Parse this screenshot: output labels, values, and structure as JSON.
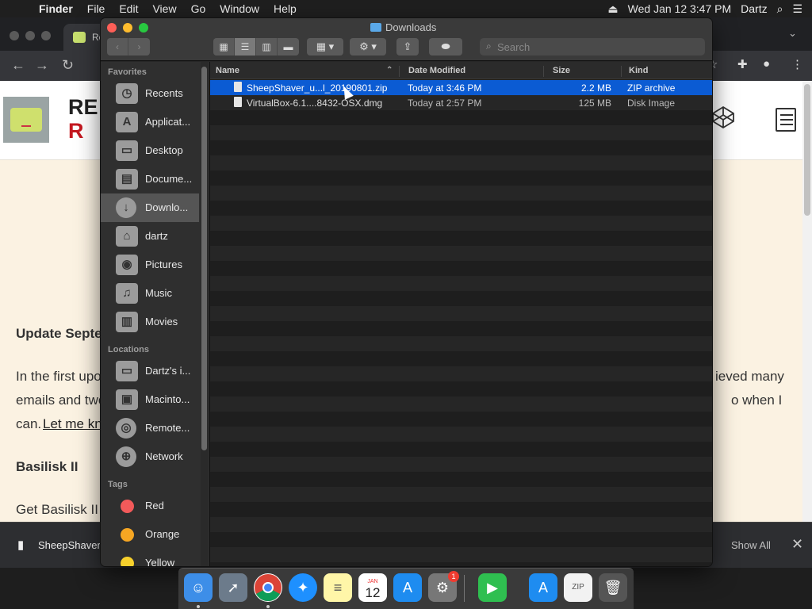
{
  "menubar": {
    "apple_icon": "apple-icon",
    "items": [
      "Finder",
      "File",
      "Edit",
      "View",
      "Go",
      "Window",
      "Help"
    ],
    "datetime": "Wed Jan 12  3:47 PM",
    "user": "Dartz"
  },
  "chrome": {
    "tab_label": "Re",
    "site_title_line1": "RE",
    "site_title_line2": "R",
    "content": {
      "heading1": "Update Septe",
      "para1_line1": "In the first upo",
      "para1_line1_right": "ieved many",
      "para1_line2": "emails and twe",
      "para1_line2_right": "o when I",
      "para1_line3_prefix": "can.",
      "para1_line3_link": "Let me kn",
      "heading2": "Basilisk II",
      "para2": "Get Basilisk II ("
    },
    "download_bar": {
      "file_name": "SheepShaver",
      "show_all": "Show All",
      "close_icon": "close-icon"
    }
  },
  "finder": {
    "title": "Downloads",
    "search_placeholder": "Search",
    "sidebar": {
      "favorites_heading": "Favorites",
      "favorites": [
        {
          "label": "Recents",
          "icon": "clock-icon"
        },
        {
          "label": "Applicat...",
          "icon": "applications-icon"
        },
        {
          "label": "Desktop",
          "icon": "desktop-icon"
        },
        {
          "label": "Docume...",
          "icon": "documents-icon"
        },
        {
          "label": "Downlo...",
          "icon": "downloads-icon"
        },
        {
          "label": "dartz",
          "icon": "home-icon"
        },
        {
          "label": "Pictures",
          "icon": "pictures-icon"
        },
        {
          "label": "Music",
          "icon": "music-icon"
        },
        {
          "label": "Movies",
          "icon": "movies-icon"
        }
      ],
      "locations_heading": "Locations",
      "locations": [
        {
          "label": "Dartz's i...",
          "icon": "computer-icon"
        },
        {
          "label": "Macinto...",
          "icon": "hard-drive-icon"
        },
        {
          "label": "Remote...",
          "icon": "remote-disc-icon"
        },
        {
          "label": "Network",
          "icon": "network-icon"
        }
      ],
      "tags_heading": "Tags",
      "tags": [
        {
          "label": "Red",
          "color": "#f25a5a"
        },
        {
          "label": "Orange",
          "color": "#f6a623"
        },
        {
          "label": "Yellow",
          "color": "#f7d02c"
        }
      ]
    },
    "columns": {
      "name": "Name",
      "date_modified": "Date Modified",
      "size": "Size",
      "kind": "Kind"
    },
    "files": [
      {
        "name": "SheepShaver_u...l_20190801.zip",
        "date": "Today at 3:46 PM",
        "size": "2.2 MB",
        "kind": "ZIP archive",
        "selected": true
      },
      {
        "name": "VirtualBox-6.1....8432-OSX.dmg",
        "date": "Today at 2:57 PM",
        "size": "125 MB",
        "kind": "Disk Image",
        "selected": false
      }
    ]
  },
  "dock": {
    "items": [
      {
        "name": "finder-icon",
        "label": "Finder"
      },
      {
        "name": "launchpad-icon",
        "label": "Launchpad"
      },
      {
        "name": "chrome-icon",
        "label": "Chrome"
      },
      {
        "name": "safari-icon",
        "label": "Safari"
      },
      {
        "name": "notes-icon",
        "label": "Notes"
      },
      {
        "name": "calendar-icon",
        "label": "Calendar"
      },
      {
        "name": "app-store-icon",
        "label": "App Store"
      },
      {
        "name": "system-preferences-icon",
        "label": "System Preferences"
      },
      {
        "name": "facetime-icon",
        "label": "FaceTime"
      },
      {
        "name": "app-store-icon",
        "label": "App Store"
      },
      {
        "name": "zip-file-icon",
        "label": "ZIP"
      },
      {
        "name": "trash-icon",
        "label": "Trash"
      }
    ],
    "calendar_month": "JAN",
    "calendar_day": "12",
    "badge_count": "1"
  }
}
